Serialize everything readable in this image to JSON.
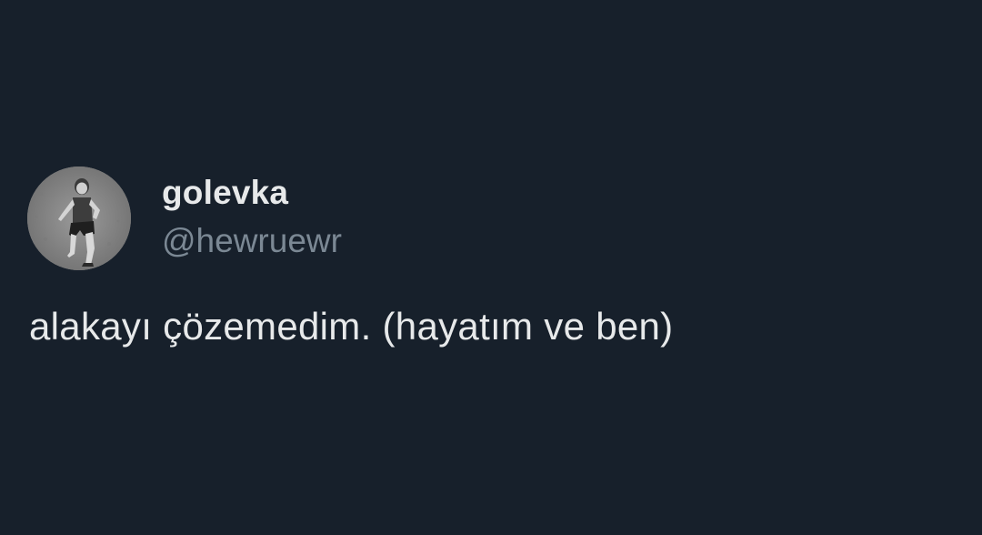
{
  "tweet": {
    "author": {
      "display_name": "golevka",
      "handle": "@hewruewr",
      "avatar_icon": "running-person-photo"
    },
    "text": "alakayı çözemedim. (hayatım ve ben)"
  },
  "colors": {
    "background": "#17202b",
    "primary_text": "#e7e9ea",
    "secondary_text": "#7b8894"
  }
}
